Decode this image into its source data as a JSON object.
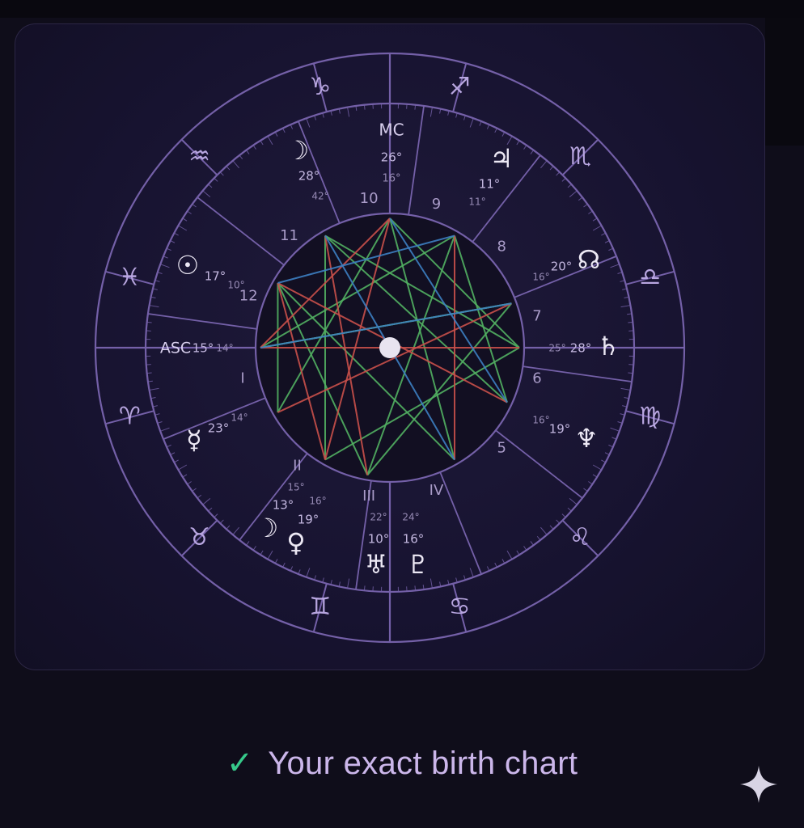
{
  "footer": {
    "check_glyph": "✓",
    "caption": "Your exact birth chart"
  },
  "chart_data": {
    "type": "natal-chart-wheel",
    "angles": [
      {
        "label": "MC",
        "deg": "26°",
        "min": "16°"
      },
      {
        "label": "ASC",
        "deg": "15°",
        "min": "14°"
      }
    ],
    "zodiac_signs": [
      {
        "name": "capricorn",
        "glyph": "♑"
      },
      {
        "name": "sagittarius",
        "glyph": "♐"
      },
      {
        "name": "scorpio",
        "glyph": "♏"
      },
      {
        "name": "libra",
        "glyph": "♎"
      },
      {
        "name": "virgo",
        "glyph": "♍"
      },
      {
        "name": "leo",
        "glyph": "♌"
      },
      {
        "name": "cancer",
        "glyph": "♋"
      },
      {
        "name": "gemini",
        "glyph": "♊"
      },
      {
        "name": "taurus",
        "glyph": "♉"
      },
      {
        "name": "aries",
        "glyph": "♈"
      },
      {
        "name": "pisces",
        "glyph": "♓"
      },
      {
        "name": "aquarius",
        "glyph": "♒"
      }
    ],
    "house_numbers": [
      "10",
      "9",
      "8",
      "7",
      "6",
      "5",
      "IV",
      "III",
      "II",
      "I",
      "12",
      "11"
    ],
    "planets": [
      {
        "name": "moon",
        "glyph": "☽",
        "deg": "28°",
        "min": "42°"
      },
      {
        "name": "jupiter",
        "glyph": "♃",
        "deg": "11°",
        "min": "11°"
      },
      {
        "name": "north-node",
        "glyph": "☊",
        "deg": "20°",
        "min": "16°"
      },
      {
        "name": "saturn",
        "glyph": "♄",
        "deg": "28°",
        "min": "25°"
      },
      {
        "name": "neptune",
        "glyph": "♆",
        "deg": "19°",
        "min": "16°"
      },
      {
        "name": "pluto",
        "glyph": "♇",
        "deg": "16°",
        "min": "24°"
      },
      {
        "name": "uranus",
        "glyph": "♅",
        "deg": "10°",
        "min": "22°"
      },
      {
        "name": "venus",
        "glyph": "♀",
        "deg": "19°",
        "min": "16°"
      },
      {
        "name": "moon-2",
        "glyph": "☽",
        "deg": "13°",
        "min": "15°"
      },
      {
        "name": "mercury",
        "glyph": "☿",
        "deg": "23°",
        "min": "14°"
      },
      {
        "name": "sun",
        "glyph": "☉",
        "deg": "17°",
        "min": "10°"
      }
    ],
    "aspect_colors": {
      "green": "#52b062",
      "red": "#c9504a",
      "blue": "#3d7fc2"
    },
    "ring_color": "#7460a8"
  }
}
